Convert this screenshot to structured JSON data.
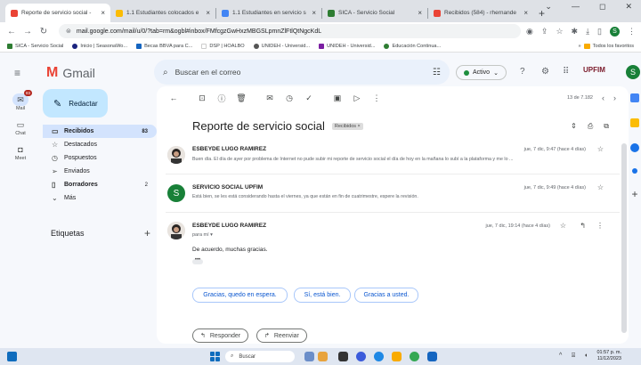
{
  "browser": {
    "tabs": [
      {
        "title": "Reporte de servicio social -",
        "color": "#ea4335",
        "active": true
      },
      {
        "title": "1.1 Estudiantes colocados e",
        "color": "#fbbc04",
        "active": false
      },
      {
        "title": "1.1 Estudiantes en servicio s",
        "color": "#4285f4",
        "active": false
      },
      {
        "title": "SICA - Servicio Social",
        "color": "#2e7d32",
        "active": false
      },
      {
        "title": "Recibidos (584) - rhernande",
        "color": "#ea4335",
        "active": false
      }
    ],
    "new_tab": "+",
    "url": "mail.google.com/mail/u/0/?tab=rm&ogbl#inbox/FMfcgzGwHxzMBGSLpmnZlFtlQtNgcKdL",
    "bookmarks": [
      {
        "label": "SICA - Servicio Social",
        "color": "#2e7d32"
      },
      {
        "label": "Inicio | SeasonaWo...",
        "color": "#1a237e"
      },
      {
        "label": "Becas BBVA para C...",
        "color": "#1565c0"
      },
      {
        "label": "DSP | HOALBO",
        "color": "#ffffff"
      },
      {
        "label": "UNIDEH - Universid...",
        "color": "#555555"
      },
      {
        "label": "UNIDEH - Universid...",
        "color": "#7b1fa2"
      },
      {
        "label": "Educación Continua...",
        "color": "#2e7d32"
      }
    ],
    "bookmarks_right": "Todos los favoritos"
  },
  "gmail": {
    "app_name": "Gmail",
    "search_placeholder": "Buscar en el correo",
    "status": "Activo",
    "org_logo": "UPFIM",
    "avatar_letter": "S",
    "compose": "Redactar",
    "rail": {
      "mail": "Mail",
      "mail_badge": "83",
      "chat": "Chat",
      "meet": "Meet"
    },
    "folders": [
      {
        "label": "Recibidos",
        "count": "83",
        "icon": "inbox-icon",
        "glyph": "▭",
        "selected": true
      },
      {
        "label": "Destacados",
        "count": "",
        "icon": "star-icon",
        "glyph": "☆",
        "selected": false
      },
      {
        "label": "Pospuestos",
        "count": "",
        "icon": "clock-icon",
        "glyph": "◷",
        "selected": false
      },
      {
        "label": "Enviados",
        "count": "",
        "icon": "send-icon",
        "glyph": "➢",
        "selected": false
      },
      {
        "label": "Borradores",
        "count": "2",
        "icon": "draft-icon",
        "glyph": "▯",
        "selected": false
      },
      {
        "label": "Más",
        "count": "",
        "icon": "chevron-down-icon",
        "glyph": "⌄",
        "selected": false
      }
    ],
    "labels_heading": "Etiquetas",
    "pager": "13 de 7.182",
    "thread": {
      "subject": "Reporte de servicio social",
      "label_chip": "Recibidos ×",
      "messages": [
        {
          "from": "ESBEYDE LUGO RAMIREZ",
          "when": "jue, 7 dic, 9:47 (hace 4 días)",
          "snippet": "Buen día. El día de ayer por problema de Internet no pude subir mi reporte de servicio social el día de hoy en la mañana lo subí a la plataforma y me lo ..."
        },
        {
          "from": "SERVICIO SOCIAL UPFIM",
          "avatar": "S",
          "when": "jue, 7 dic, 9:49 (hace 4 días)",
          "snippet": "Está bien, se les está considerando hasta el viernes, ya que están en fin de cuatrimestre, espere la revisión."
        },
        {
          "from": "ESBEYDE LUGO RAMIREZ",
          "to": "para mí ▾",
          "when": "jue, 7 dic, 19:14 (hace 4 días)",
          "body": "De acuerdo, muchas gracias.",
          "dots": "•••"
        }
      ],
      "smart_replies": [
        "Gracias, quedo en espera.",
        "Sí, está bien.",
        "Gracias a usted."
      ],
      "reply": "Responder",
      "forward": "Reenviar"
    }
  },
  "taskbar": {
    "search": "Buscar",
    "time": "01:57 p. m.",
    "date": "11/12/2023"
  }
}
